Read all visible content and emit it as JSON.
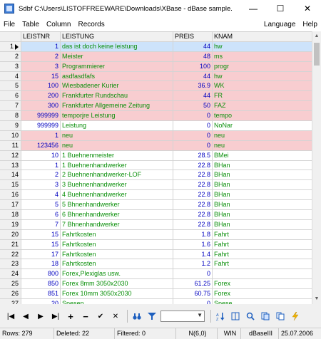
{
  "title": "Sdbf C:\\Users\\LISTOFFREEWARE\\Downloads\\XBase - dBase sample...",
  "window_buttons": {
    "minimize": "—",
    "maximize": "☐",
    "close": "✕"
  },
  "menu": {
    "file": "File",
    "table": "Table",
    "column": "Column",
    "records": "Records",
    "language": "Language",
    "help": "Help"
  },
  "columns": {
    "nr": "LEISTNR",
    "leistung": "LEISTUNG",
    "preis": "PREIS",
    "knam": "KNAM"
  },
  "rows": [
    {
      "i": "1",
      "nr": "1",
      "leistung": "das ist doch keine leistung",
      "preis": "44",
      "knam": "hw",
      "style": "sel"
    },
    {
      "i": "2",
      "nr": "2",
      "leistung": "Meister",
      "preis": "48",
      "knam": "ms",
      "style": "pink"
    },
    {
      "i": "3",
      "nr": "3",
      "leistung": "Programmierer",
      "preis": "100",
      "knam": "progr",
      "style": "pink"
    },
    {
      "i": "4",
      "nr": "15",
      "leistung": "asdfasdfafs",
      "preis": "44",
      "knam": "hw",
      "style": "pink"
    },
    {
      "i": "5",
      "nr": "100",
      "leistung": "Wiesbadener Kurier",
      "preis": "36.9",
      "knam": "WK",
      "style": "pink"
    },
    {
      "i": "6",
      "nr": "200",
      "leistung": "Frankfurter Rundschau",
      "preis": "44",
      "knam": "FR",
      "style": "pink"
    },
    {
      "i": "7",
      "nr": "300",
      "leistung": "Frankfurter Allgemeine Zeitung",
      "preis": "50",
      "knam": "FAZ",
      "style": "pink"
    },
    {
      "i": "8",
      "nr": "999999",
      "leistung": "temporjre Leistung",
      "preis": "0",
      "knam": "tempo",
      "style": "pink"
    },
    {
      "i": "9",
      "nr": "999999",
      "leistung": "Leistung",
      "preis": "0",
      "knam": "NoNar",
      "style": ""
    },
    {
      "i": "10",
      "nr": "1",
      "leistung": "neu",
      "preis": "0",
      "knam": "neu",
      "style": "pink"
    },
    {
      "i": "11",
      "nr": "123456",
      "leistung": "neu",
      "preis": "0",
      "knam": "neu",
      "style": "pink"
    },
    {
      "i": "12",
      "nr": "10",
      "leistung": "1 Buehnenmeister",
      "preis": "28.5",
      "knam": "BMei",
      "style": ""
    },
    {
      "i": "13",
      "nr": "1",
      "leistung": "1 Buehnenhandwerker",
      "preis": "22.8",
      "knam": "BHan",
      "style": ""
    },
    {
      "i": "14",
      "nr": "2",
      "leistung": "2 Buehnenhandwerker-LOF",
      "preis": "22.8",
      "knam": "BHan",
      "style": ""
    },
    {
      "i": "15",
      "nr": "3",
      "leistung": "3 Buehnenhandwerker",
      "preis": "22.8",
      "knam": "BHan",
      "style": ""
    },
    {
      "i": "16",
      "nr": "4",
      "leistung": "4 Buehnenhandwerker",
      "preis": "22.8",
      "knam": "BHan",
      "style": ""
    },
    {
      "i": "17",
      "nr": "5",
      "leistung": "5 Bhnenhandwerker",
      "preis": "22.8",
      "knam": "BHan",
      "style": ""
    },
    {
      "i": "18",
      "nr": "6",
      "leistung": "6 Bhnenhandwerker",
      "preis": "22.8",
      "knam": "BHan",
      "style": ""
    },
    {
      "i": "19",
      "nr": "7",
      "leistung": "7 Bhnenhandwerker",
      "preis": "22.8",
      "knam": "BHan",
      "style": ""
    },
    {
      "i": "20",
      "nr": "15",
      "leistung": "Fahrtkosten",
      "preis": "1.8",
      "knam": "Fahrt",
      "style": ""
    },
    {
      "i": "21",
      "nr": "15",
      "leistung": "Fahrtkosten",
      "preis": "1.6",
      "knam": "Fahrt",
      "style": ""
    },
    {
      "i": "22",
      "nr": "17",
      "leistung": "Fahrtkosten",
      "preis": "1.4",
      "knam": "Fahrt",
      "style": ""
    },
    {
      "i": "23",
      "nr": "18",
      "leistung": "Fahrtkosten",
      "preis": "1.2",
      "knam": "Fahrt",
      "style": ""
    },
    {
      "i": "24",
      "nr": "800",
      "leistung": "Forex,Plexiglas usw.",
      "preis": "0",
      "knam": "",
      "style": ""
    },
    {
      "i": "25",
      "nr": "850",
      "leistung": "Forex 8mm 3050x2030",
      "preis": "61.25",
      "knam": "Forex",
      "style": ""
    },
    {
      "i": "26",
      "nr": "851",
      "leistung": "Forex 10mm 3050x2030",
      "preis": "60.75",
      "knam": "Forex",
      "style": ""
    },
    {
      "i": "27",
      "nr": "20",
      "leistung": "Spesen",
      "preis": "0",
      "knam": "Spese",
      "style": ""
    }
  ],
  "toolbar": {
    "first": "|◀",
    "prior": "◀",
    "next": "▶",
    "last": "▶|",
    "insert": "+",
    "delete": "−",
    "post": "✔",
    "cancel": "✕"
  },
  "status": {
    "rows": "Rows: 279",
    "deleted": "Deleted: 22",
    "filtered": "Filtered: 0",
    "type": "N(6,0)",
    "encoding": "WIN",
    "format": "dBaseIII",
    "date": "25.07.2006"
  }
}
